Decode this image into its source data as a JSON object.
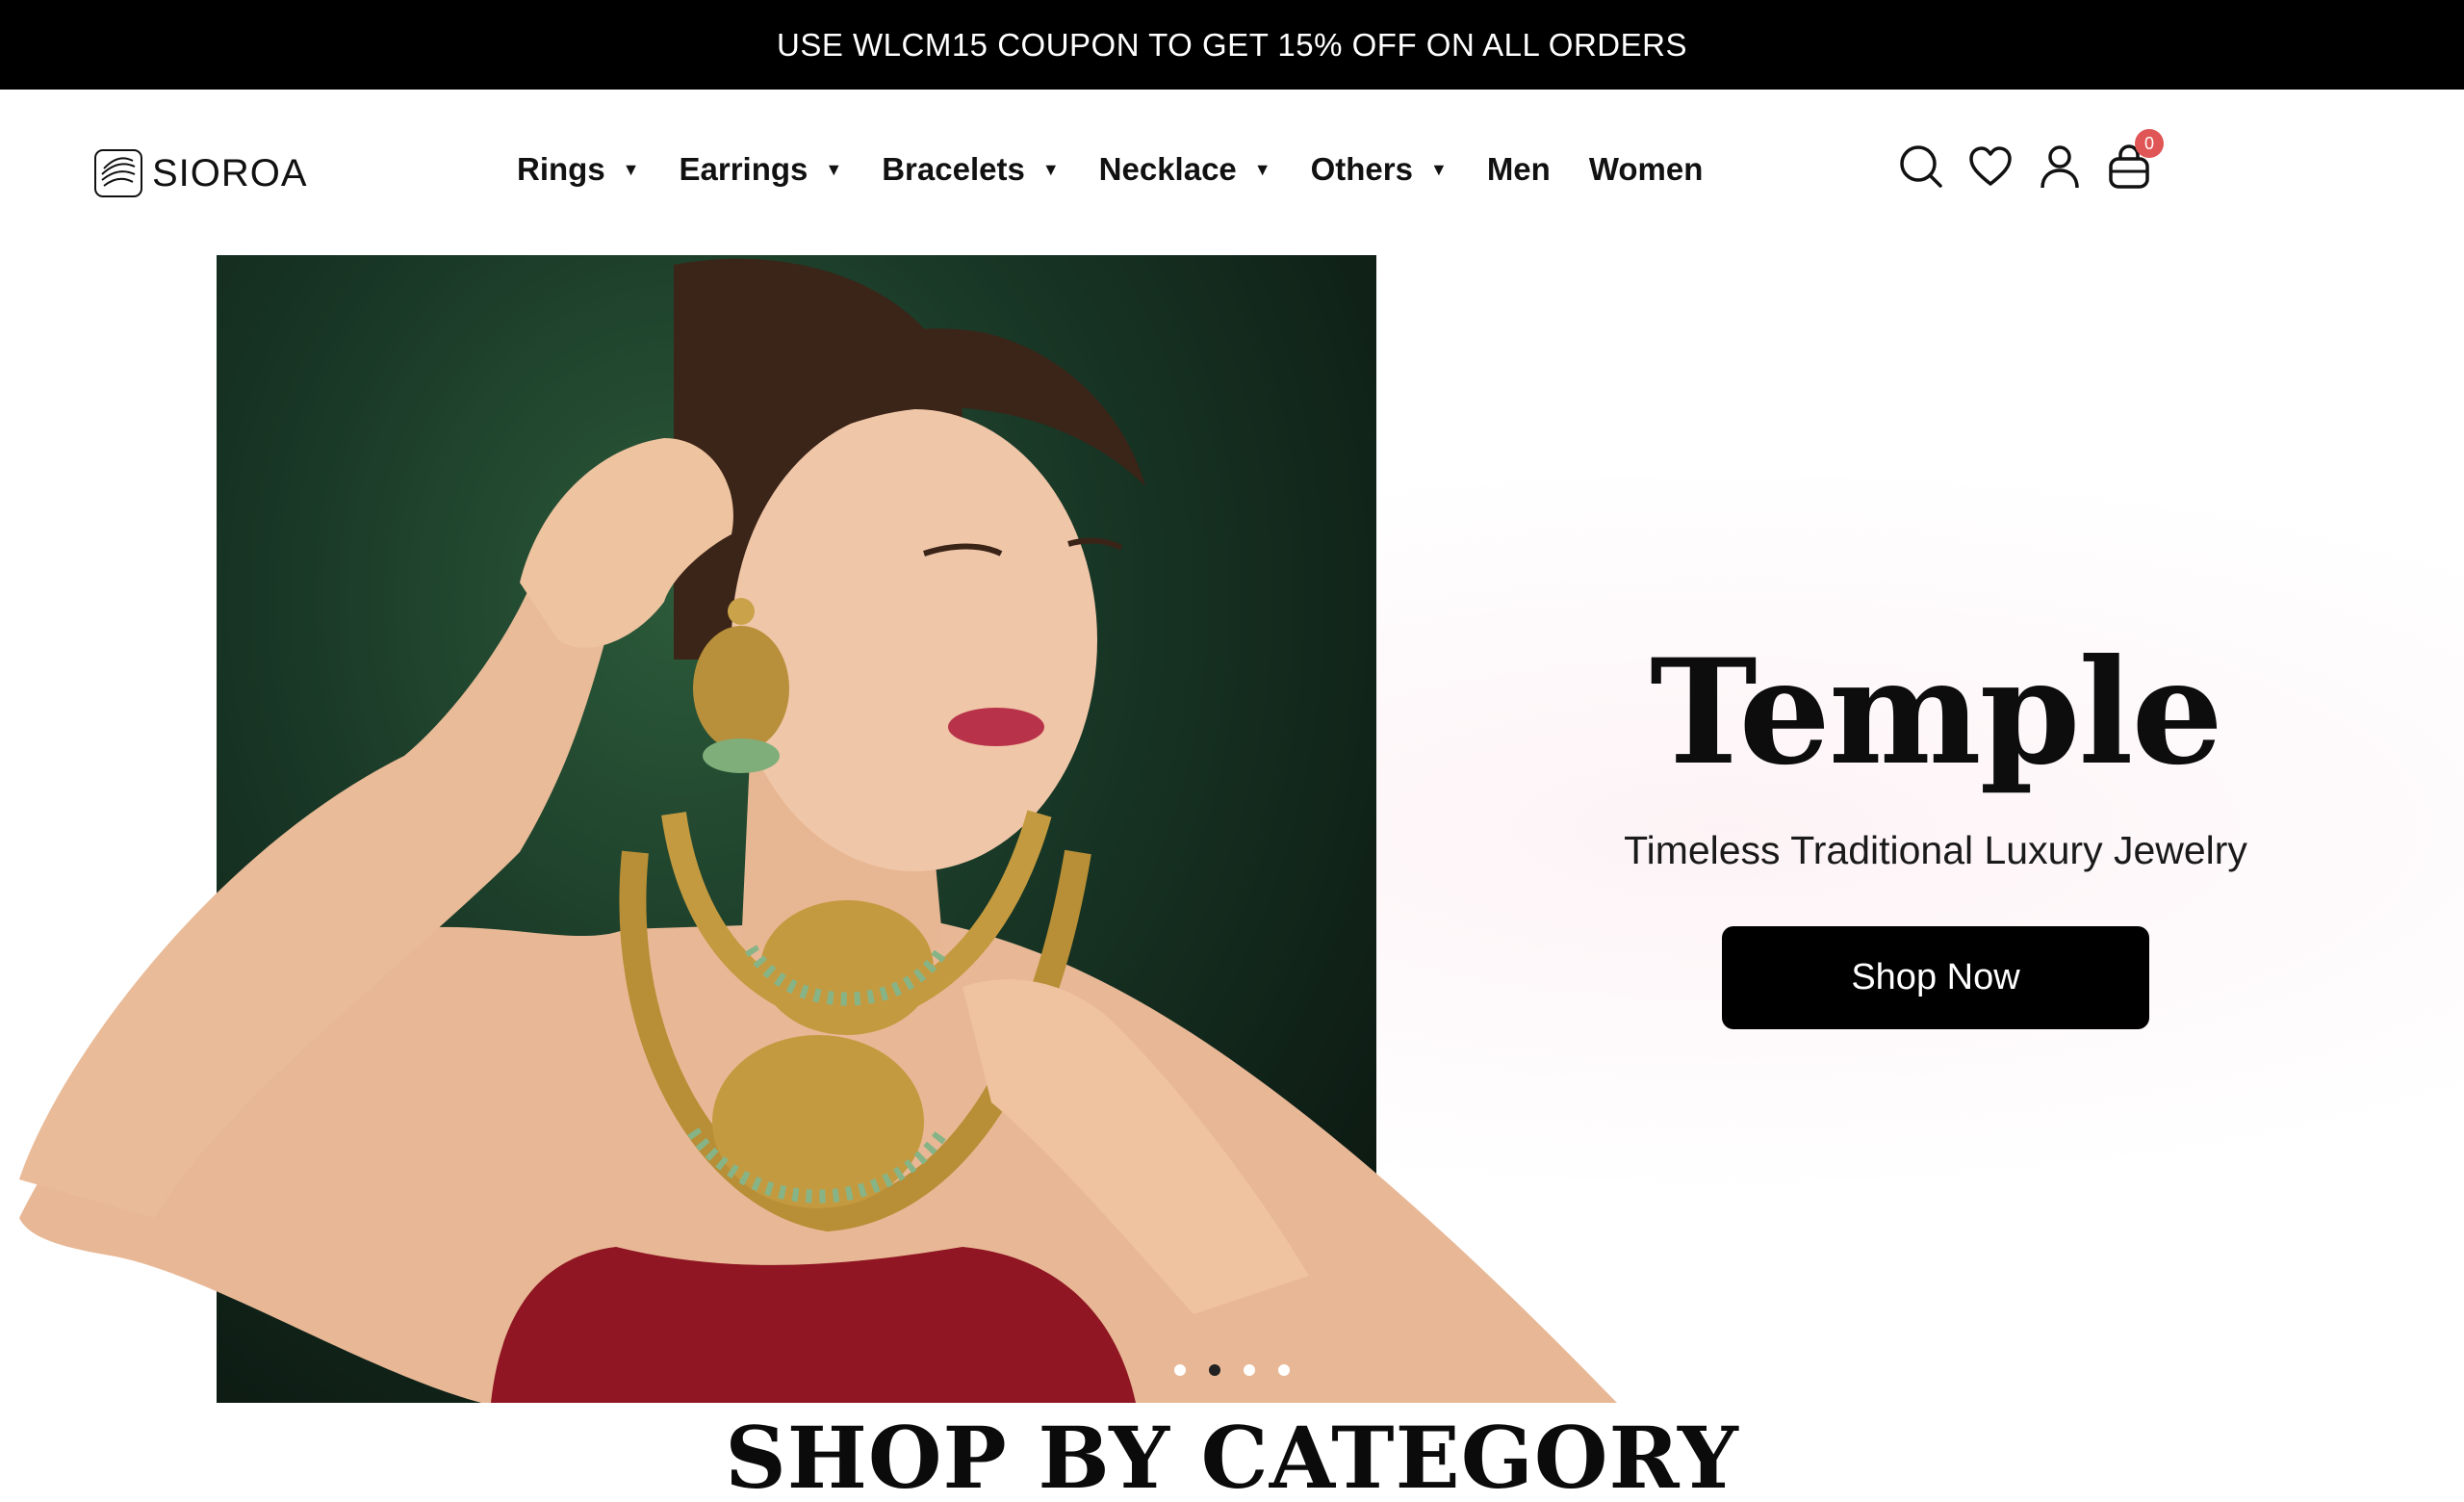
{
  "announcement": {
    "text": "USE WLCM15 COUPON TO GET 15% OFF ON ALL ORDERS"
  },
  "brand": {
    "name": "SIOROA"
  },
  "nav": {
    "items": [
      {
        "label": "Rings",
        "has_dropdown": true
      },
      {
        "label": "Earrings",
        "has_dropdown": true
      },
      {
        "label": "Bracelets",
        "has_dropdown": true
      },
      {
        "label": "Necklace",
        "has_dropdown": true
      },
      {
        "label": "Others",
        "has_dropdown": true
      },
      {
        "label": "Men",
        "has_dropdown": false
      },
      {
        "label": "Women",
        "has_dropdown": false
      }
    ],
    "caret": "▼"
  },
  "header_icons": {
    "search": "search-icon",
    "wishlist": "heart-icon",
    "account": "user-icon",
    "cart": "shopping-bag-icon",
    "cart_count": "0"
  },
  "hero": {
    "title": "Temple",
    "subtitle": "Timeless Traditional Luxury Jewelry",
    "cta_label": "Shop Now",
    "slides_count": 4,
    "active_slide": 1
  },
  "sections": {
    "shop_by_category": "SHOP BY CATEGORY"
  },
  "colors": {
    "announcement_bg": "#000000",
    "cta_bg": "#000000",
    "badge": "#e05555",
    "text": "#111111"
  }
}
